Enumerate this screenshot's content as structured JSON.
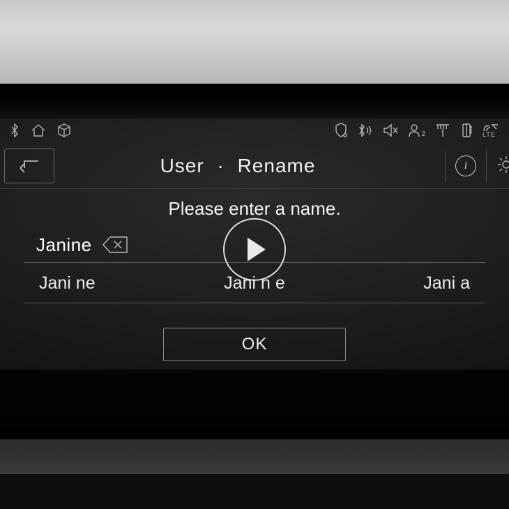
{
  "status_icons_left": [
    "bluetooth-icon",
    "home-icon",
    "cube-icon"
  ],
  "status_icons_right": [
    "shield-location-icon",
    "bluetooth-signal-icon",
    "mute-icon",
    "user-badge-icon",
    "antenna-icon",
    "phone-signal-icon",
    "lte-icon"
  ],
  "header": {
    "breadcrumb_1": "User",
    "separator": "·",
    "breadcrumb_2": "Rename"
  },
  "prompt": "Please enter a name.",
  "input": {
    "value": "Janine"
  },
  "suggestions": [
    "Jani ne",
    "Jani n e",
    "Jani a"
  ],
  "ok_label": "OK",
  "lte_label": "LTE",
  "badge_number": "2"
}
